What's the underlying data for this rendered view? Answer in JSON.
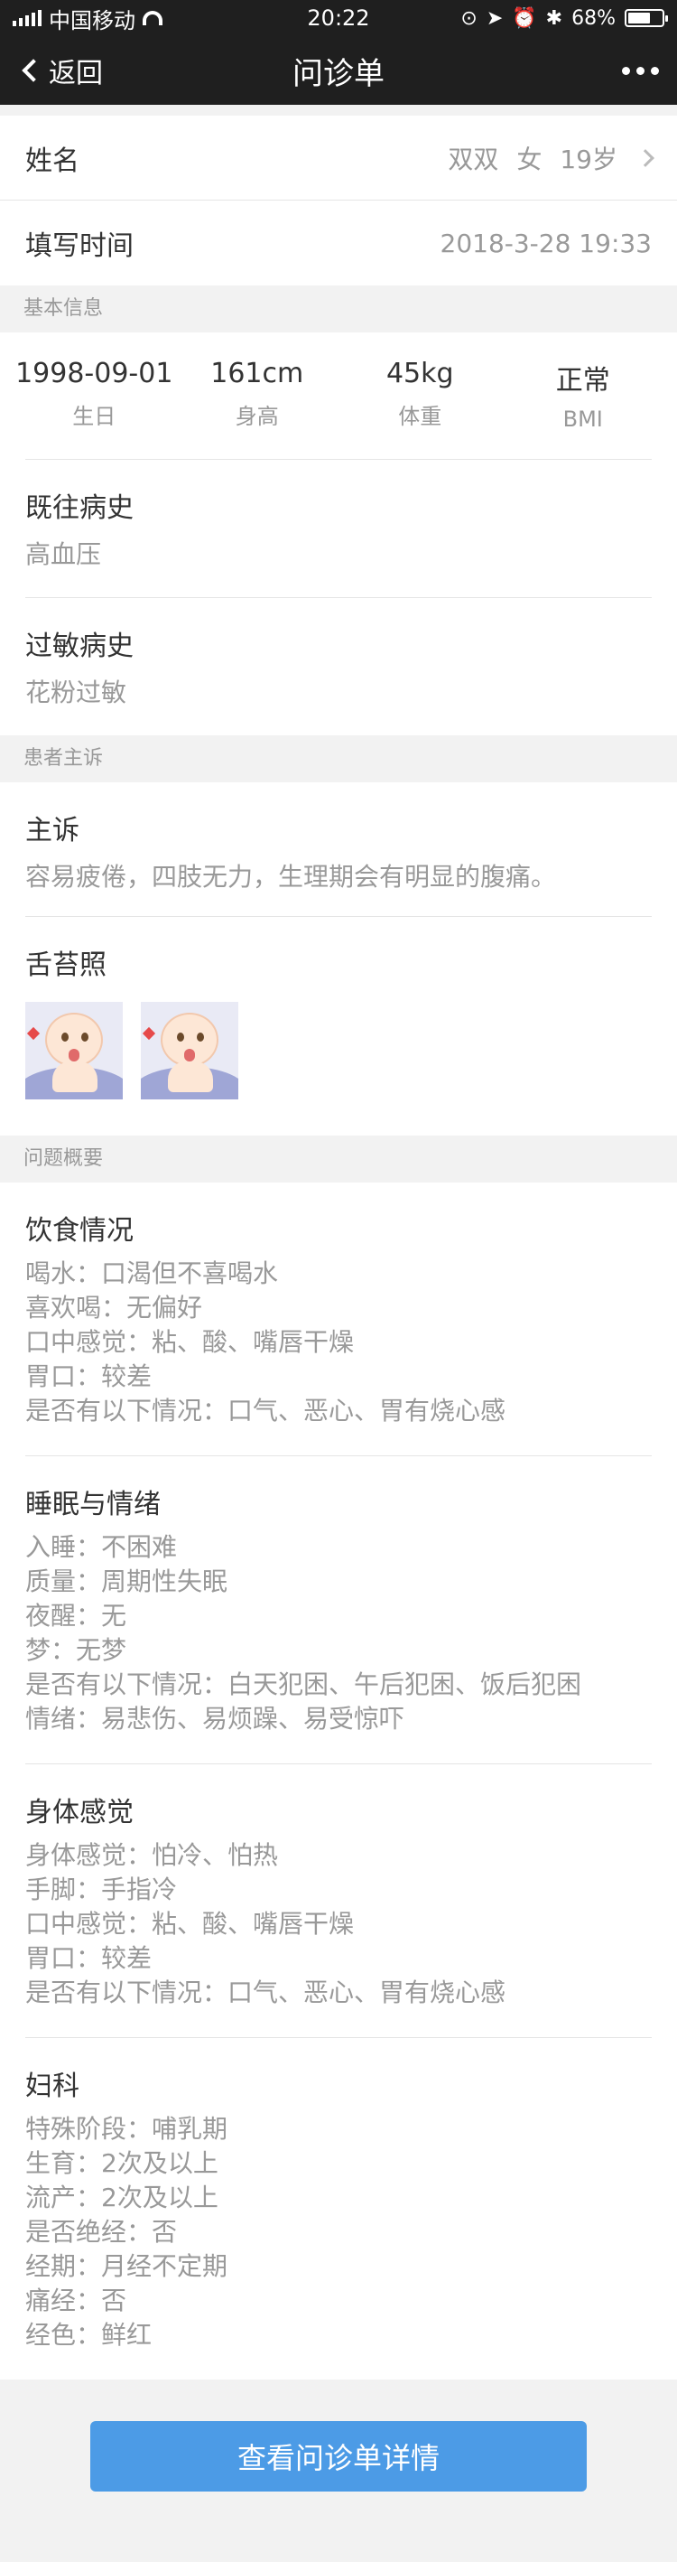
{
  "status_bar": {
    "carrier": "中国移动",
    "time": "20:22",
    "battery": "68%",
    "battery_level": 0.68
  },
  "nav": {
    "back_label": "返回",
    "title": "问诊单"
  },
  "patient": {
    "name_label": "姓名",
    "name": "双双",
    "gender": "女",
    "age": "19岁",
    "time_label": "填写时间",
    "fill_time": "2018-3-28  19:33"
  },
  "basic_info": {
    "section_title": "基本信息",
    "stats": [
      {
        "value": "1998-09-01",
        "label": "生日"
      },
      {
        "value": "161cm",
        "label": "身高"
      },
      {
        "value": "45kg",
        "label": "体重"
      },
      {
        "value": "正常",
        "label": "BMI"
      }
    ],
    "history_title": "既往病史",
    "history_text": "高血压",
    "allergy_title": "过敏病史",
    "allergy_text": "花粉过敏"
  },
  "complaint": {
    "section_title": "患者主诉",
    "main_title": "主诉",
    "main_text": "容易疲倦，四肢无力，生理期会有明显的腹痛。",
    "tongue_title": "舌苔照"
  },
  "overview": {
    "section_title": "问题概要",
    "groups": [
      {
        "title": "饮食情况",
        "lines": [
          "喝水：口渴但不喜喝水",
          "喜欢喝：无偏好",
          "口中感觉：粘、酸、嘴唇干燥",
          "胃口：较差",
          "是否有以下情况：口气、恶心、胃有烧心感"
        ]
      },
      {
        "title": "睡眠与情绪",
        "lines": [
          "入睡：不困难",
          "质量：周期性失眠",
          "夜醒：无",
          "梦：无梦",
          "是否有以下情况：白天犯困、午后犯困、饭后犯困",
          "情绪：易悲伤、易烦躁、易受惊吓"
        ]
      },
      {
        "title": "身体感觉",
        "lines": [
          "身体感觉：怕冷、怕热",
          "手脚：手指冷",
          "口中感觉：粘、酸、嘴唇干燥",
          "胃口：较差",
          "是否有以下情况：口气、恶心、胃有烧心感"
        ]
      },
      {
        "title": "妇科",
        "lines": [
          "特殊阶段：哺乳期",
          "生育：2次及以上",
          "流产：2次及以上",
          "是否绝经：否",
          "经期：月经不定期",
          "痛经：否",
          "经色：鲜红"
        ]
      }
    ]
  },
  "footer": {
    "button_label": "查看问诊单详情"
  }
}
